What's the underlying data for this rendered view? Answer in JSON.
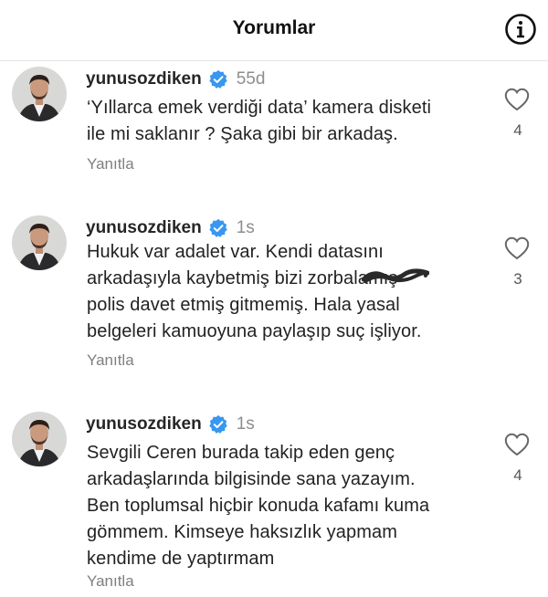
{
  "header": {
    "title": "Yorumlar",
    "info_icon": "info-icon"
  },
  "comments": [
    {
      "username": "yunusozdiken",
      "time": "55d",
      "lines": [
        "‘Yıllarca emek verdiği data’ kamera disketi",
        "ile mi saklanır ? Şaka gibi bir arkadaş."
      ],
      "reply_label": "Yanıtla",
      "likes": "4"
    },
    {
      "username": "yunusozdiken",
      "time": "1s",
      "lines": [
        "Hukuk var adalet var. Kendi datasını",
        "arkadaşıyla kaybetmiş bizi zorbalamış",
        "polis davet etmiş gitmemiş. Hala yasal",
        "belgeleri kamuoyuna paylaşıp suç işliyor."
      ],
      "reply_label": "Yanıtla",
      "likes": "3"
    },
    {
      "username": "yunusozdiken",
      "time": "1s",
      "lines": [
        "Sevgili Ceren burada takip eden genç",
        "arkadaşlarında bilgisinde sana yazayım.",
        "Ben toplumsal hiçbir konuda kafamı kuma",
        "gömmem. Kimseye haksızlık yapmam",
        "kendime de yaptırmam"
      ],
      "reply_label": "Yanıtla",
      "likes": "4"
    }
  ],
  "colors": {
    "verified_badge": "#3897f0",
    "muted_text": "#8e8e8e"
  }
}
